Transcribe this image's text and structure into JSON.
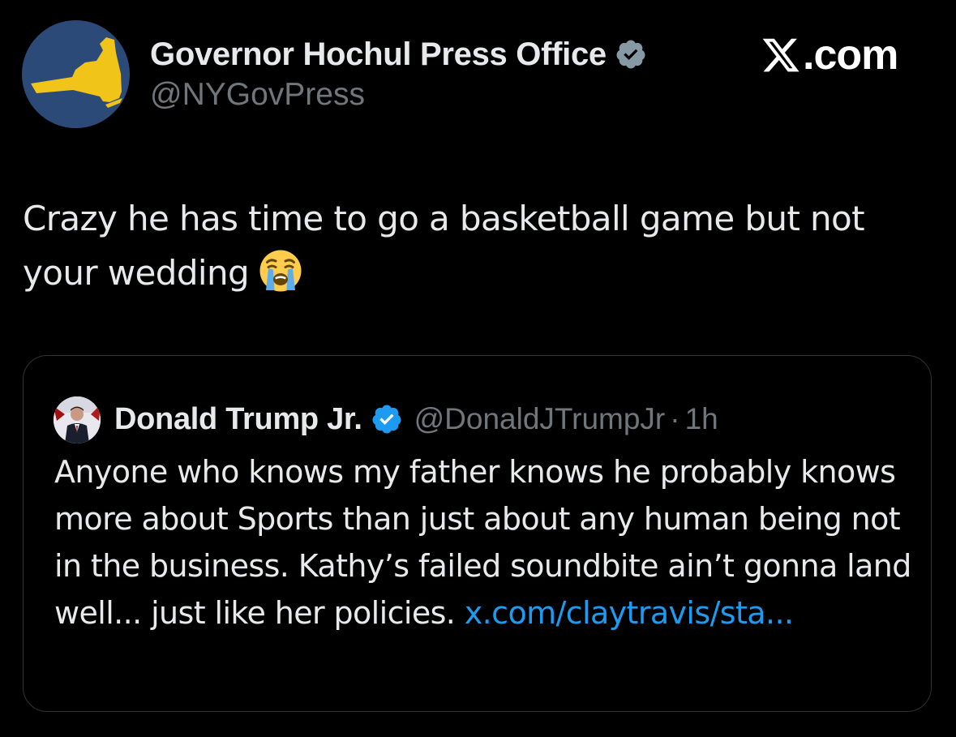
{
  "tweet": {
    "author": {
      "display_name": "Governor Hochul Press Office",
      "handle": "@NYGovPress",
      "verified": true,
      "verified_badge_color": "#8899a6",
      "avatar": "new-york-state-map-logo"
    },
    "text": "Crazy he has time to go a basketball game but not your wedding",
    "emoji": "loudly-crying-face-emoji"
  },
  "watermark": {
    "text": ".com",
    "icon": "x-logo"
  },
  "quoted_tweet": {
    "author": {
      "display_name": "Donald Trump Jr.",
      "handle": "@DonaldJTrumpJr",
      "separator": "·",
      "time": "1h",
      "verified": true,
      "verified_badge_color": "#1d9bf0",
      "avatar": "profile-photo"
    },
    "text": "Anyone who knows my father knows he probably knows more about Sports than just about any human being not in the business. Kathy’s failed soundbite ain’t gonna land well... just like her policies.",
    "link": "x.com/claytravis/sta..."
  },
  "colors": {
    "background": "#000000",
    "text_primary": "#e7e9ea",
    "text_secondary": "#71767b",
    "link": "#1d9bf0",
    "card_border": "#2f3336",
    "avatar_bg": "#2b4a77",
    "state_map_fill": "#f0c419"
  }
}
